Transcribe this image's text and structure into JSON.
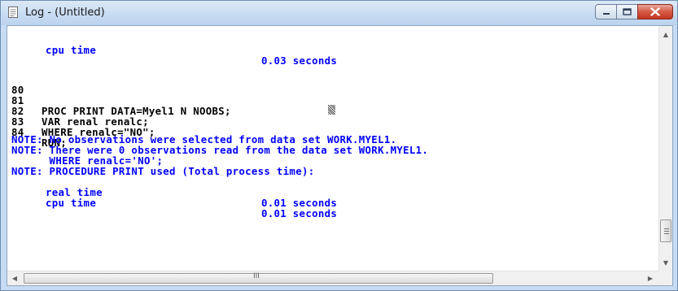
{
  "window": {
    "title": "Log - (Untitled)",
    "icon": "log-document-icon"
  },
  "caption_buttons": {
    "minimize_icon": "minimize-icon",
    "maximize_icon": "maximize-icon",
    "close_icon": "close-icon"
  },
  "log_lines": {
    "l0": "cpu time",
    "l0_val": "0.03 seconds",
    "l3_num": "80",
    "l4_num": "81",
    "l4_src": "PROC PRINT DATA=Myel1 N NOOBS;",
    "l5_num": "82",
    "l5_src": "VAR renal renalc;",
    "l6_num": "83",
    "l6_src": "WHERE renalc=\"NO\";",
    "l7_num": "84",
    "l7_src": "RUN;",
    "n1": "NOTE: No observations were selected from data set WORK.MYEL1.",
    "n2": "NOTE: There were 0 observations read from the data set WORK.MYEL1.",
    "n3": "      WHERE renalc='NO';",
    "n4": "NOTE: PROCEDURE PRINT used (Total process time):",
    "n5_label": "real time",
    "n5_val": "0.01 seconds",
    "n6_label": "cpu time",
    "n6_val": "0.01 seconds"
  },
  "scrollbars": {
    "up_arrow": "▲",
    "down_arrow": "▼",
    "left_arrow": "◀",
    "right_arrow": "▶",
    "hthumb_label": "III"
  },
  "colors": {
    "note": "#0000ff",
    "source": "#000000",
    "frame": "#c7dbf2",
    "close_button": "#c2351f"
  }
}
